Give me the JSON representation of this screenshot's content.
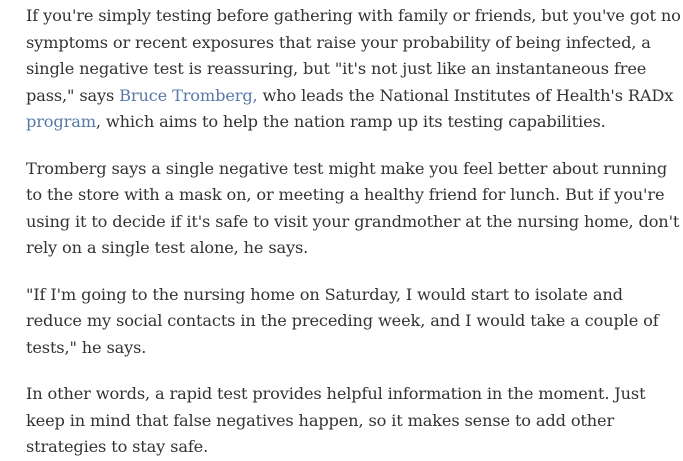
{
  "article": {
    "p1": {
      "before_link1": "If you're simply testing before gathering with family or friends, but you've got no symptoms or recent exposures that raise your probability of being infected, a single negative test is reassuring, but \"it's not just like an instantaneous free pass,\" says ",
      "link1": "Bruce Tromberg,",
      "between_links": " who leads the National Institutes of Health's RADx ",
      "link2": "program",
      "after_link2": ", which aims to help the nation ramp up its testing capabilities."
    },
    "p2": "Tromberg says a single negative test might make you feel better about running to the store with a mask on, or meeting a healthy friend for lunch. But if you're using it to decide if it's safe to visit your grandmother at the nursing home, don't rely on a single test alone, he says.",
    "p3": "\"If I'm going to the nursing home on Saturday, I would start to isolate and reduce my social contacts in the preceding week, and I would take a couple of tests,\" he says.",
    "p4": "In other words, a rapid test provides helpful information in the moment. Just keep in mind that false negatives happen, so it makes sense to add other strategies to stay safe."
  },
  "colors": {
    "text": "#333333",
    "link": "#5778a8",
    "background": "#ffffff"
  }
}
